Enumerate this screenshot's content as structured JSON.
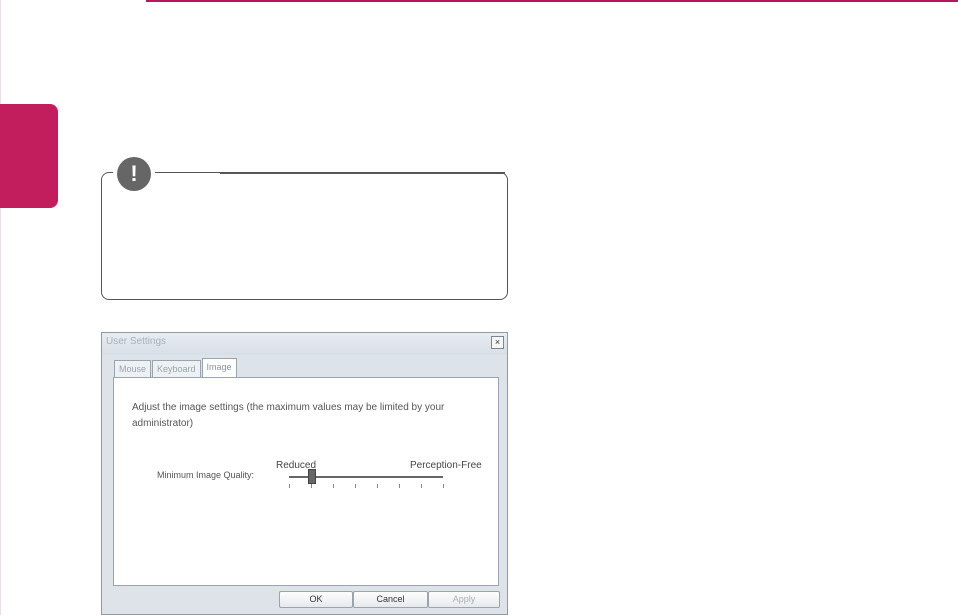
{
  "dialog": {
    "title": "User Settings",
    "close_glyph": "×",
    "tabs": [
      {
        "label": "Mouse"
      },
      {
        "label": "Keyboard"
      },
      {
        "label": "Image"
      }
    ],
    "description": "Adjust the image settings (the maximum values may be limited by your administrator)",
    "slider": {
      "label": "Minimum Image Quality:",
      "min_label": "Reduced",
      "max_label": "Perception-Free",
      "position_fraction": 0.14,
      "tick_count": 8
    },
    "buttons": {
      "ok": "OK",
      "cancel": "Cancel",
      "apply": "Apply"
    }
  },
  "note": {
    "icon_glyph": "!"
  },
  "colors": {
    "accent": "#c21d5d"
  }
}
